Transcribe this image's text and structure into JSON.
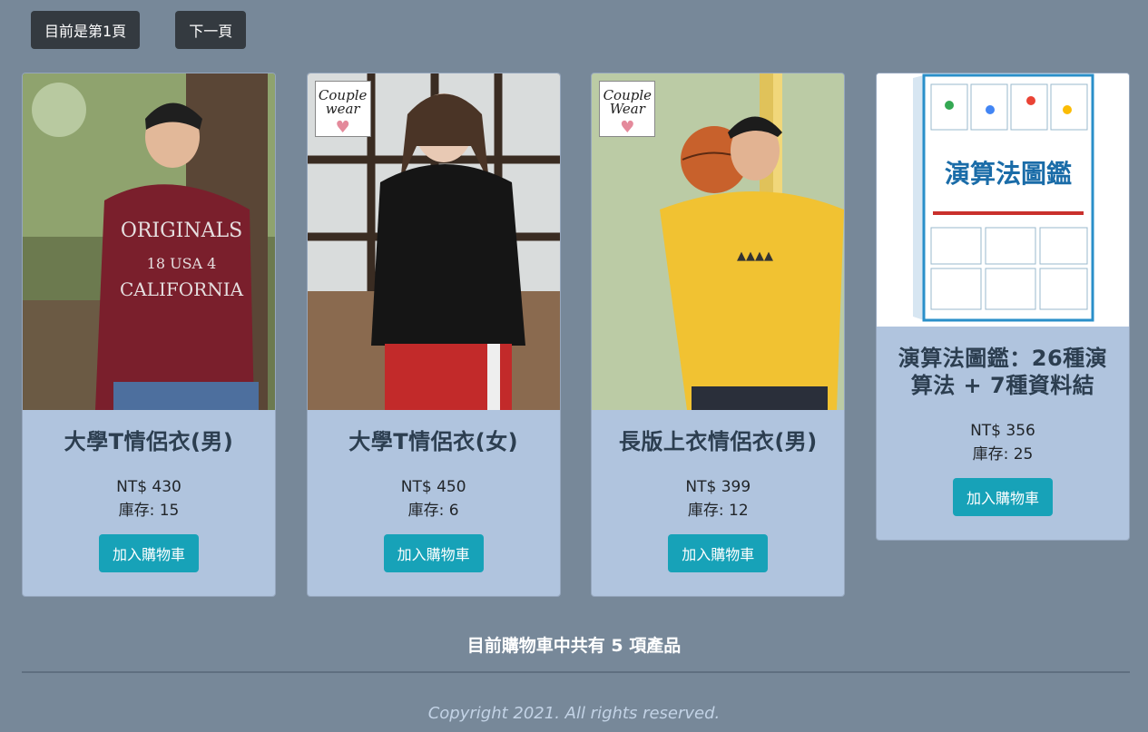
{
  "topbar": {
    "page_label": "目前是第1頁",
    "next_label": "下一頁"
  },
  "products": [
    {
      "name": "大學T情侶衣(男)",
      "price": "NT$ 430",
      "stock": "庫存: 15",
      "button": "加入購物車"
    },
    {
      "name": "大學T情侶衣(女)",
      "price": "NT$ 450",
      "stock": "庫存: 6",
      "button": "加入購物車",
      "logo": "Couple wear"
    },
    {
      "name": "長版上衣情侶衣(男)",
      "price": "NT$ 399",
      "stock": "庫存: 12",
      "button": "加入購物車",
      "logo": "Couple Wear"
    },
    {
      "name": "演算法圖鑑：26種演算法 + 7種資料結",
      "price": "NT$ 356",
      "stock": "庫存: 25",
      "button": "加入購物車",
      "cover_title": "演算法圖鑑"
    }
  ],
  "cart_summary": "目前購物車中共有 5 項產品",
  "copyright": "Copyright 2021. All rights reserved.",
  "colors": {
    "page_bg": "#778899",
    "card_bg": "#b0c4de",
    "nav_button": "#343a40",
    "add_button": "#17a2b8"
  }
}
